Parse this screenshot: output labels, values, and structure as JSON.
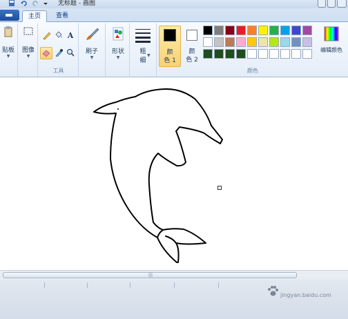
{
  "window": {
    "title": "无标题 - 画图"
  },
  "tabs": [
    {
      "label": "主页",
      "active": true
    },
    {
      "label": "查看",
      "active": false
    }
  ],
  "ribbon": {
    "clipboard_label": "贴板",
    "image_label": "图像",
    "tools_group_label": "工具",
    "brush_label": "刷子",
    "shapes_label": "形状",
    "size_label_1": "粗",
    "size_label_2": "细",
    "color1_label_1": "颜",
    "color1_label_2": "色 1",
    "color2_label_1": "颜",
    "color2_label_2": "色 2",
    "colors_group_label": "颜色",
    "edit_colors_label": "编辑颜色",
    "text_tool_glyph": "A"
  },
  "palette": {
    "color1": "#000000",
    "color2": "#ffffff",
    "row1": [
      "#000000",
      "#7f7f7f",
      "#880015",
      "#ed1c24",
      "#ff7f27",
      "#fff200",
      "#22b14c",
      "#00a2e8",
      "#3f48cc",
      "#a349a4"
    ],
    "row2": [
      "#ffffff",
      "#c3c3c3",
      "#b97a57",
      "#ffaec9",
      "#ffc90e",
      "#efe4b0",
      "#b5e61d",
      "#99d9ea",
      "#7092be",
      "#c8bfe7"
    ],
    "row3": [
      "#1e4d1e",
      "#1e4d1e",
      "#1e4d1e",
      "#1e4d1e",
      "#ffffff",
      "#ffffff",
      "#ffffff",
      "#ffffff",
      "#ffffff",
      "#ffffff"
    ]
  },
  "colors": {
    "ribbon_bg": "#e4edf8",
    "tab_text": "#15428b",
    "selected_highlight": "#f8d274"
  },
  "icons": {
    "save": "save-icon",
    "undo": "undo-icon",
    "redo": "redo-icon",
    "pencil": "pencil-icon",
    "fill": "fill-bucket-icon",
    "text": "text-icon",
    "eraser": "eraser-icon",
    "picker": "color-picker-icon",
    "magnifier": "magnifier-icon"
  },
  "watermark": {
    "text": "jingyan.baidu.com"
  }
}
